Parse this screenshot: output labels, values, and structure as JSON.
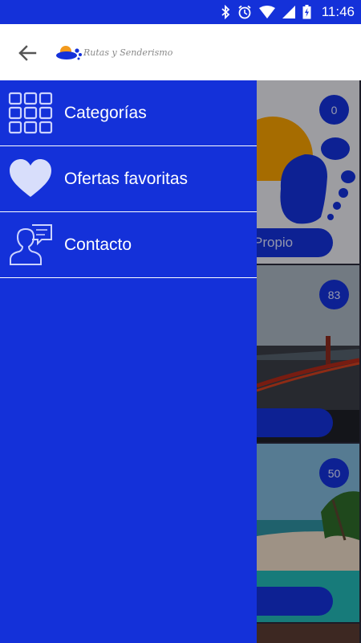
{
  "status_bar": {
    "time": "11:46"
  },
  "app_bar": {
    "logo_text": "Rutas y Senderismo"
  },
  "drawer": {
    "items": [
      {
        "label": "Categorías",
        "icon": "grid-icon"
      },
      {
        "label": "Ofertas favoritas",
        "icon": "heart-icon"
      },
      {
        "label": "Contacto",
        "icon": "contact-person-icon"
      }
    ]
  },
  "cards": [
    {
      "count": "0",
      "button_label": "Propio"
    },
    {
      "count": "83",
      "button_label": ""
    },
    {
      "count": "50",
      "button_label": ""
    }
  ],
  "colors": {
    "primary": "#1431d9",
    "app_bar": "#ffffff",
    "divider": "#ffffff"
  }
}
